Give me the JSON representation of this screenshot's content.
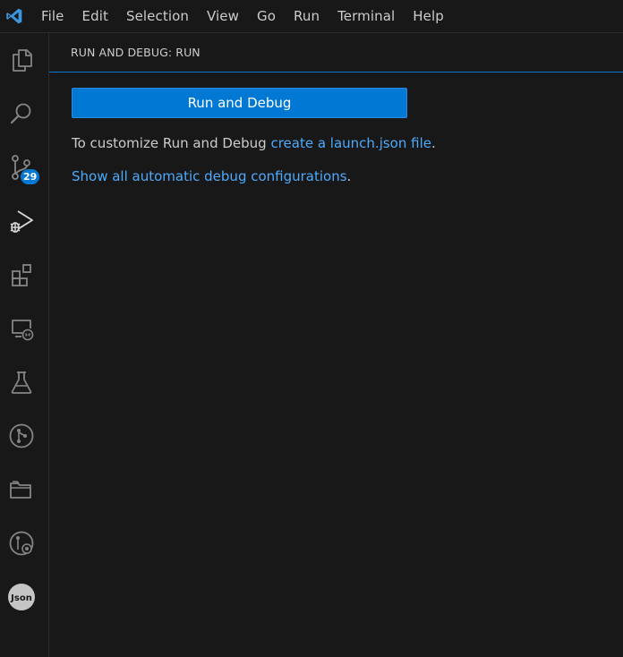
{
  "menubar": {
    "items": [
      "File",
      "Edit",
      "Selection",
      "View",
      "Go",
      "Run",
      "Terminal",
      "Help"
    ]
  },
  "activity_bar": {
    "items": [
      {
        "name": "explorer-icon"
      },
      {
        "name": "search-icon"
      },
      {
        "name": "source-control-icon",
        "badge": "29"
      },
      {
        "name": "run-debug-icon",
        "active": true
      },
      {
        "name": "extensions-icon"
      },
      {
        "name": "remote-explorer-icon"
      },
      {
        "name": "testing-icon"
      },
      {
        "name": "git-graph-icon"
      },
      {
        "name": "folder-icon"
      },
      {
        "name": "git-history-icon"
      },
      {
        "name": "json-icon",
        "label": "Json"
      }
    ]
  },
  "sidebar": {
    "title": "RUN AND DEBUG: RUN",
    "run_button_label": "Run and Debug",
    "customize_text": "To customize Run and Debug ",
    "customize_link": "create a launch.json file",
    "customize_suffix": ".",
    "show_all_link": "Show all automatic debug configurations",
    "show_all_suffix": "."
  },
  "colors": {
    "accent": "#0078d4",
    "link": "#4daafc",
    "background": "#181818",
    "foreground": "#cccccc"
  }
}
